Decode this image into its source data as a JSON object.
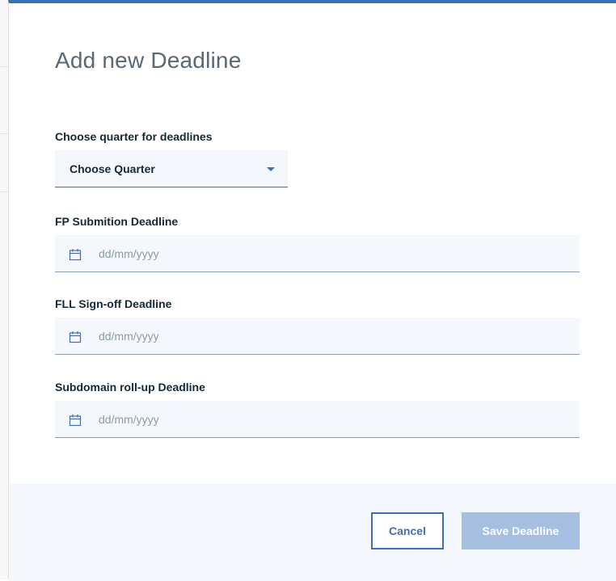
{
  "modal": {
    "title": "Add new Deadline",
    "accent_color": "#3d70b2"
  },
  "quarter": {
    "label": "Choose quarter for deadlines",
    "selected": "Choose Quarter",
    "icon": "caret-down-icon"
  },
  "fields": [
    {
      "label": "FP Submition Deadline",
      "placeholder": "dd/mm/yyyy",
      "icon": "calendar-icon"
    },
    {
      "label": "FLL Sign-off Deadline",
      "placeholder": "dd/mm/yyyy",
      "icon": "calendar-icon"
    },
    {
      "label": "Subdomain roll-up Deadline",
      "placeholder": "dd/mm/yyyy",
      "icon": "calendar-icon"
    }
  ],
  "footer": {
    "cancel_label": "Cancel",
    "save_label": "Save Deadline",
    "save_color": "#a6bfe0"
  }
}
